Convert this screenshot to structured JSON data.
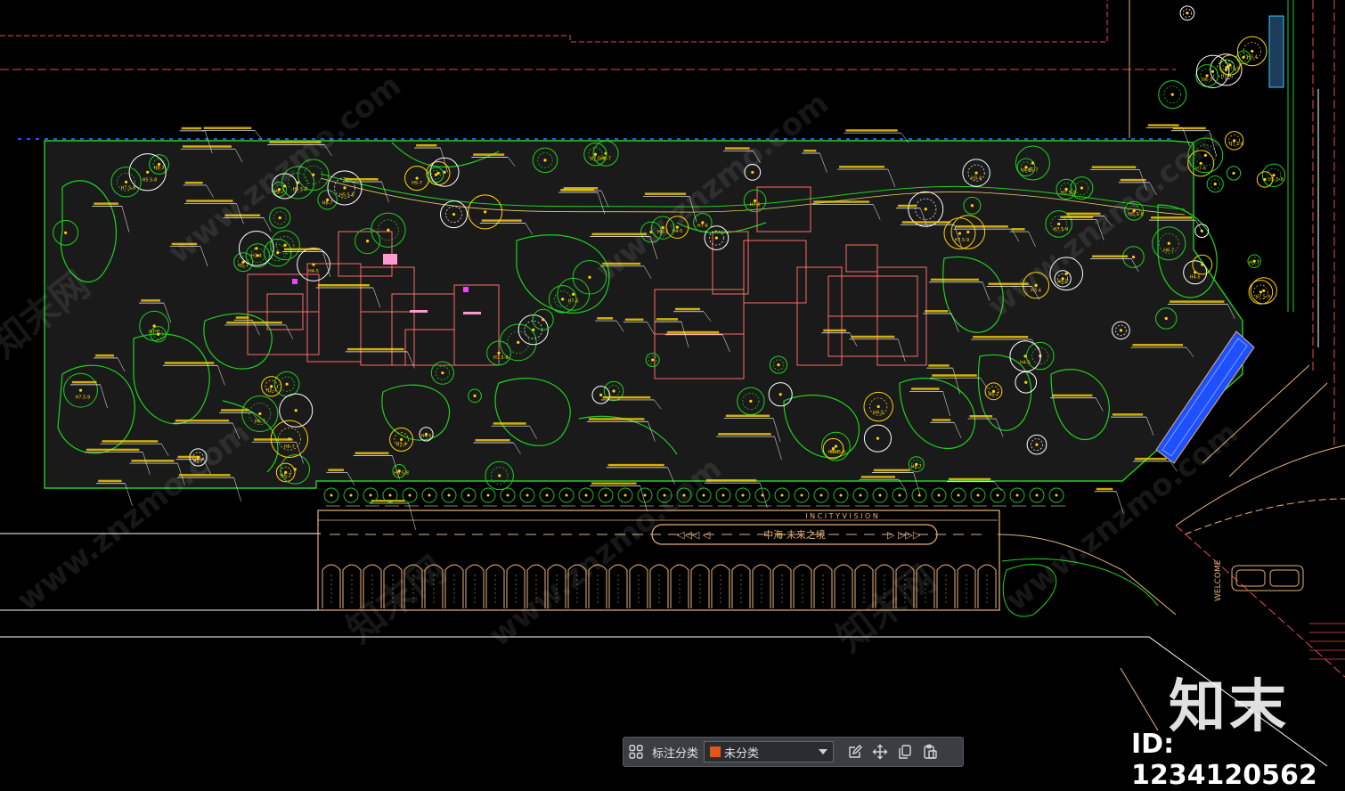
{
  "drawing": {
    "plaza_sign": "中海·未来之境",
    "entry_text": "WELCOME",
    "strip_text": "I N    C I T Y    V I S I O N",
    "plant_codes": [
      "H7.5-8",
      "H7-6",
      "H8-7",
      "H5.5-8",
      "H7.5-9",
      "H5-7",
      "H4-5",
      "H6-7",
      "H3-4"
    ]
  },
  "watermark": {
    "site": "www.znzmo.com",
    "brand": "知末网"
  },
  "logo": "知末",
  "doc_id": "ID: 1234120562",
  "toolbar": {
    "label": "标注分类",
    "selected": "未分类",
    "swatch_color": "#e0561c",
    "icons": [
      "grid-icon",
      "edit-icon",
      "move-icon",
      "copy-icon",
      "paste-icon"
    ]
  },
  "colors": {
    "background": "#000000",
    "vegetation": "#1fd11f",
    "buildings": "#ff6b6b",
    "pavement": "#e8b37a",
    "leaders": "#ffffff",
    "labels": "#ffd400",
    "water": "#1e50ff"
  }
}
